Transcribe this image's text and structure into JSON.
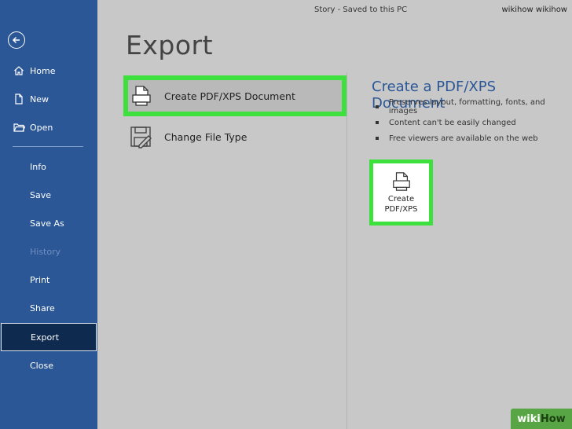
{
  "window": {
    "title": "Story  -  Saved to this PC",
    "user": "wikihow wikihow"
  },
  "sidebar": {
    "back_icon": "back-arrow-icon",
    "items": [
      {
        "label": "Home",
        "icon": "home-icon"
      },
      {
        "label": "New",
        "icon": "new-document-icon"
      },
      {
        "label": "Open",
        "icon": "open-folder-icon"
      },
      {
        "label": "Info"
      },
      {
        "label": "Save"
      },
      {
        "label": "Save As"
      },
      {
        "label": "History",
        "disabled": true
      },
      {
        "label": "Print"
      },
      {
        "label": "Share"
      },
      {
        "label": "Export",
        "active": true
      },
      {
        "label": "Close"
      }
    ]
  },
  "main": {
    "title": "Export",
    "options": [
      {
        "label": "Create PDF/XPS Document",
        "icon": "pdf-document-icon",
        "highlighted": true
      },
      {
        "label": "Change File Type",
        "icon": "change-file-type-icon"
      }
    ]
  },
  "panel": {
    "title": "Create a PDF/XPS Document",
    "bullets": [
      "Preserves layout, formatting, fonts, and images",
      "Content can't be easily changed",
      "Free viewers are available on the web"
    ],
    "button_line1": "Create",
    "button_line2": "PDF/XPS",
    "button_icon": "pdf-document-icon"
  },
  "watermark": {
    "part1": "wiki",
    "part2": "How"
  },
  "colors": {
    "sidebar": "#2b5797",
    "active_item": "#0e2a4f",
    "highlight": "#3de03d",
    "content_bg": "#c8c8c8",
    "panel_title": "#2b5797"
  }
}
